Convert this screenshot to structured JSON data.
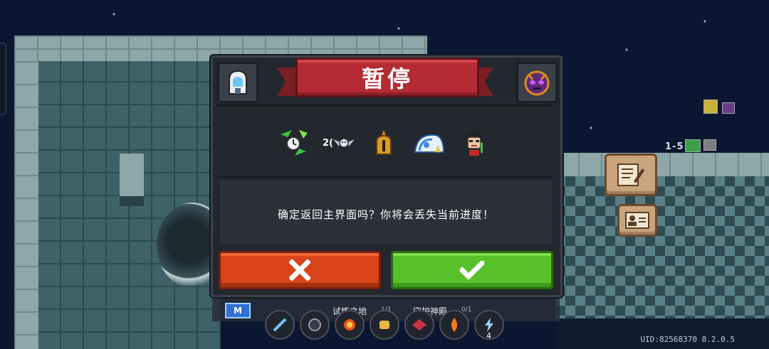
{
  "dialog": {
    "title": "暂停",
    "message": "确定返回主界面吗？你将会丢失当前进度！",
    "items": [
      {
        "icon": "green-arrows-clock-buff-icon"
      },
      {
        "icon": "bat-pet-icon",
        "count": "2("
      },
      {
        "icon": "golden-helmet-buff-icon"
      },
      {
        "icon": "blue-wave-buff-icon"
      },
      {
        "icon": "character-portrait-buff-icon"
      }
    ],
    "cancel_icon": "close-x-icon",
    "confirm_icon": "checkmark-icon",
    "left_badge_icon": "ghost-character-icon",
    "right_badge_icon": "purple-demon-mask-icon"
  },
  "hud": {
    "mode_badge": "M",
    "stage_label": "试炼之地",
    "stage_count": "1/1",
    "boss_label": "守护神殿",
    "boss_count": "0/1",
    "skill_number": "4",
    "skills": [
      "blue-slash-skill-icon",
      "dark-orb-skill-icon",
      "fire-burst-skill-icon",
      "gold-fist-skill-icon",
      "red-wing-skill-icon",
      "flame-skill-icon",
      "lightning-bolt-skill-icon"
    ],
    "uid": "UID:82568370 8.2.0.5"
  },
  "minimap": {
    "level": "1-5"
  },
  "side_buttons": [
    "notes-edit-icon",
    "profile-card-icon"
  ],
  "colors": {
    "ribbon": "#b52b33",
    "cancel": "#d9441b",
    "confirm": "#58c12a",
    "dialog_bg": "#23272e"
  }
}
